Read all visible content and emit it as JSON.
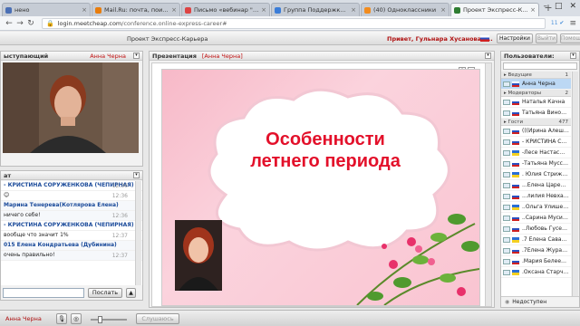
{
  "browser": {
    "tabs": [
      {
        "label": "нено",
        "fav": "#4a6fb5"
      },
      {
        "label": "Mail.Ru: почта, поиск в инт",
        "fav": "#e87d0d"
      },
      {
        "label": "Письмо «вебинар \"Особе",
        "fav": "#d44"
      },
      {
        "label": "Группа Поддержки Webin",
        "fav": "#3b7dd8"
      },
      {
        "label": "(40) Одноклассники",
        "fav": "#f28c1e"
      },
      {
        "label": "Проект Экспресс-Карьер",
        "fav": "#2e7d32"
      }
    ],
    "new_tab": "+",
    "url_host": "login.meetcheap.com",
    "url_path": "/conference.online-express-career#",
    "badge": "11 ✔",
    "menu_icon": "≡"
  },
  "app": {
    "project_title": "Проект Экспресс-Карьера",
    "greeting": "Привет, Гульнара Хусанова (...",
    "settings_label": "Настройки",
    "exit_label": "Выйти",
    "help_label": "Помощь"
  },
  "speaker_panel": {
    "title": "ыступающий",
    "name": "Анна Черна"
  },
  "chat": {
    "title": "ат",
    "messages": [
      {
        "author": "- КРИСТИНА СОРУЖЕНКОВА (ЧЕПИРНАЯ)",
        "text": "",
        "time": "12:36"
      },
      {
        "author": "",
        "text": "😊",
        "time": "12:36"
      },
      {
        "author": "Марина Тенерева(Котлярова Елена)",
        "text": "",
        "time": ""
      },
      {
        "author": "",
        "text": "ничего себе!",
        "time": "12:36"
      },
      {
        "author": "- КРИСТИНА СОРУЖЕНКОВА (ЧЕПИРНАЯ)",
        "text": "",
        "time": ""
      },
      {
        "author": "",
        "text": "вообще что значит 1%",
        "time": "12:37"
      },
      {
        "author": "015 Елена Кондратьева (Дубинина)",
        "text": "",
        "time": ""
      },
      {
        "author": "",
        "text": "очень правильно!",
        "time": "12:37"
      }
    ],
    "send_label": "Послать"
  },
  "presentation": {
    "title": "Презентация",
    "presenter": "[Анна Черна]",
    "slide_title_line1": "Особенности",
    "slide_title_line2": "летнего периода"
  },
  "users": {
    "title": "Пользователи:",
    "groups": [
      {
        "name": "▸ Ведущие",
        "count": "1",
        "members": [
          {
            "name": "Анна Черна",
            "flag": "ru",
            "selected": true
          }
        ]
      },
      {
        "name": "▸ Модераторы",
        "count": "2",
        "members": [
          {
            "name": "Наталья Качна",
            "flag": "ru"
          },
          {
            "name": "Татьяна Виноградова",
            "flag": "ru"
          }
        ]
      },
      {
        "name": "▸ Гости",
        "count": "477",
        "members": [
          {
            "name": "(((Ирина Алешко (Тата",
            "flag": "ru"
          },
          {
            "name": "- КРИСТИНА СОРУЖЕН",
            "flag": "ru"
          },
          {
            "name": "-Лесе Настасюк(Бога",
            "flag": "ua"
          },
          {
            "name": "-Татьяна Муссолитина",
            "flag": "ru"
          },
          {
            "name": ". Юлия Стрижак (Старч",
            "flag": "ua"
          },
          {
            "name": "...Елена Царенко)",
            "flag": "ru"
          },
          {
            "name": "...лилия Невха(конкров",
            "flag": "ru"
          },
          {
            "name": "..Ольга Улишева (Ха",
            "flag": "ua"
          },
          {
            "name": "..Сарина Мусипова(Ц",
            "flag": "ru"
          },
          {
            "name": "..Любовь Гусева (Фоме",
            "flag": "ru"
          },
          {
            "name": ".7 Елена Саванская(Ц",
            "flag": "ua"
          },
          {
            "name": ".7Елена Журавлева (Ста",
            "flag": "ru"
          },
          {
            "name": ".Мария Белеева (Старч",
            "flag": "ru"
          },
          {
            "name": ".Оксана Старчак(Персо",
            "flag": "ua"
          }
        ]
      }
    ],
    "footer_label": "Недоступен"
  },
  "statusbar": {
    "me": "Анна Черна",
    "raise_label": "Слушаюсь"
  }
}
